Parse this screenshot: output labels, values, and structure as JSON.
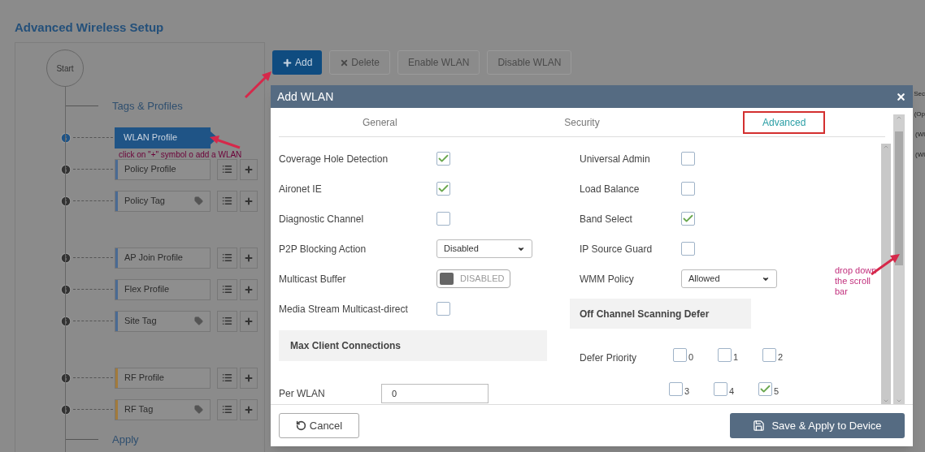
{
  "page_title": "Advanced Wireless Setup",
  "workflow": {
    "start_label": "Start",
    "heading": "Tags & Profiles",
    "footer_heading": "Apply",
    "groups": [
      [
        {
          "label": "WLAN Profile",
          "selected": true,
          "tagged": false
        },
        {
          "label": "Policy Profile",
          "selected": false,
          "tagged": false,
          "color": "#4a6a93"
        },
        {
          "label": "Policy Tag",
          "selected": false,
          "tagged": true,
          "color": "#4a6a93"
        }
      ],
      [
        {
          "label": "AP Join Profile",
          "selected": false,
          "tagged": false,
          "color": "#4a6a93"
        },
        {
          "label": "Flex Profile",
          "selected": false,
          "tagged": false,
          "color": "#4a6a93"
        },
        {
          "label": "Site Tag",
          "selected": false,
          "tagged": true,
          "color": "#4a6a93"
        }
      ],
      [
        {
          "label": "RF Profile",
          "selected": false,
          "tagged": false,
          "color": "#a27a3c"
        },
        {
          "label": "RF Tag",
          "selected": false,
          "tagged": true,
          "color": "#a27a3c"
        }
      ]
    ]
  },
  "toolbar": [
    {
      "kind": "add",
      "label": "Add",
      "disabled": false
    },
    {
      "kind": "delete",
      "label": "Delete",
      "disabled": true
    },
    {
      "kind": "plain",
      "label": "Enable WLAN",
      "disabled": true
    },
    {
      "kind": "plain",
      "label": "Disable WLAN",
      "disabled": true
    }
  ],
  "background_fragments": [
    "Sec",
    "(Op",
    "(Wl",
    "(Wl"
  ],
  "modal": {
    "title": "Add WLAN",
    "tabs": [
      {
        "label": "General",
        "selected": false
      },
      {
        "label": "Security",
        "selected": false
      },
      {
        "label": "Advanced",
        "selected": true
      }
    ],
    "left_fields": [
      {
        "kind": "checkbox",
        "label": "Coverage Hole Detection",
        "checked": true
      },
      {
        "kind": "checkbox",
        "label": "Aironet IE",
        "checked": true
      },
      {
        "kind": "checkbox",
        "label": "Diagnostic Channel",
        "checked": false
      },
      {
        "kind": "select",
        "label": "P2P Blocking Action",
        "value": "Disabled"
      },
      {
        "kind": "toggle",
        "label": "Multicast Buffer",
        "value": "DISABLED",
        "on": false
      },
      {
        "kind": "checkbox",
        "label": "Media Stream Multicast-direct",
        "checked": false
      }
    ],
    "right_fields": [
      {
        "kind": "checkbox",
        "label": "Universal Admin",
        "checked": false
      },
      {
        "kind": "checkbox",
        "label": "Load Balance",
        "checked": false
      },
      {
        "kind": "checkbox",
        "label": "Band Select",
        "checked": true
      },
      {
        "kind": "checkbox",
        "label": "IP Source Guard",
        "checked": false
      },
      {
        "kind": "select",
        "label": "WMM Policy",
        "value": "Allowed"
      }
    ],
    "max_client": {
      "heading": "Max Client Connections",
      "label": "Per WLAN",
      "value": "0"
    },
    "off_channel": {
      "heading": "Off Channel Scanning Defer",
      "label": "Defer Priority",
      "options": [
        {
          "label": "0",
          "checked": false
        },
        {
          "label": "1",
          "checked": false
        },
        {
          "label": "2",
          "checked": false
        },
        {
          "label": "3",
          "checked": false
        },
        {
          "label": "4",
          "checked": false
        },
        {
          "label": "5",
          "checked": true
        }
      ]
    },
    "cancel": "Cancel",
    "save": "Save & Apply to Device"
  },
  "annotations": [
    "click on \"+\" symbol o add a WLAN",
    "drop down the scroll bar"
  ]
}
